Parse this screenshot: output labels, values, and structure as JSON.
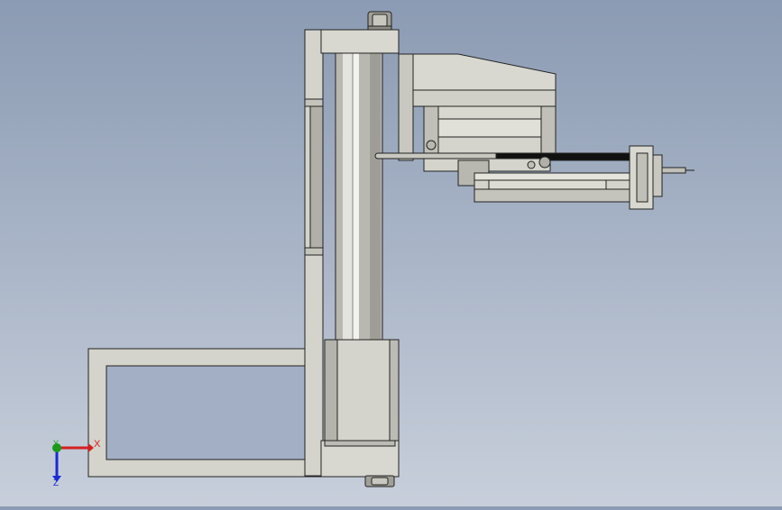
{
  "viewport": {
    "model": "linear-actuator-assembly",
    "view": "front"
  },
  "triad": {
    "x_label": "X",
    "y_label": "Y",
    "z_label": "Z",
    "x_color": "#d42020",
    "y_color": "#1a9a1a",
    "z_color": "#1a2ad4"
  },
  "colors": {
    "part_fill": "#d4d4cc",
    "part_dark": "#a9a9a1",
    "part_shadow": "#8f8f88",
    "edge": "#222222",
    "bolt": "#9a9a92"
  }
}
